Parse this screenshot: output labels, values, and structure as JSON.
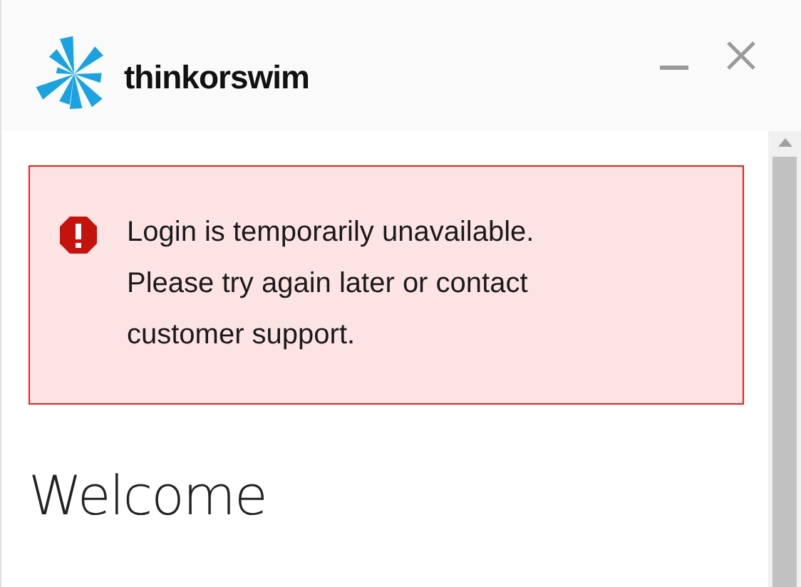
{
  "window": {
    "logo_text": "thinkorswim"
  },
  "alert": {
    "kind": "error",
    "message": "Login is temporarily unavailable. Please try again later or contact customer support."
  },
  "heading": "Welcome"
}
